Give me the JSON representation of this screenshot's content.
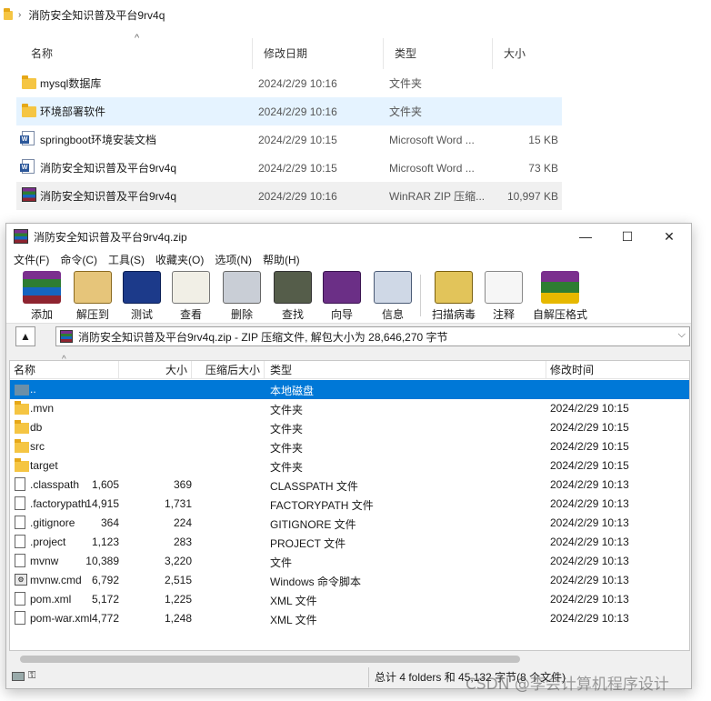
{
  "explorer": {
    "breadcrumb": "消防安全知识普及平台9rv4q",
    "headers": [
      "名称",
      "修改日期",
      "类型",
      "大小"
    ],
    "rows": [
      {
        "name": "mysql数据库",
        "date": "2024/2/29 10:16",
        "type": "文件夹",
        "size": "",
        "icon": "folder-icon"
      },
      {
        "name": "环境部署软件",
        "date": "2024/2/29 10:16",
        "type": "文件夹",
        "size": "",
        "icon": "folder-icon"
      },
      {
        "name": "springboot环境安装文档",
        "date": "2024/2/29 10:15",
        "type": "Microsoft Word ...",
        "size": "15 KB",
        "icon": "word-doc-icon"
      },
      {
        "name": "消防安全知识普及平台9rv4q",
        "date": "2024/2/29 10:15",
        "type": "Microsoft Word ...",
        "size": "73 KB",
        "icon": "word-doc-icon"
      },
      {
        "name": "消防安全知识普及平台9rv4q",
        "date": "2024/2/29 10:16",
        "type": "WinRAR ZIP 压缩...",
        "size": "10,997 KB",
        "icon": "winrar-archive-icon"
      }
    ]
  },
  "winrar": {
    "title": "消防安全知识普及平台9rv4q.zip",
    "window_buttons": {
      "minimize": "—",
      "maximize": "☐",
      "close": "✕"
    },
    "menu": [
      "文件(F)",
      "命令(C)",
      "工具(S)",
      "收藏夹(O)",
      "选项(N)",
      "帮助(H)"
    ],
    "toolbar": [
      "添加",
      "解压到",
      "测试",
      "查看",
      "删除",
      "查找",
      "向导",
      "信息",
      "扫描病毒",
      "注释",
      "自解压格式"
    ],
    "address": "消防安全知识普及平台9rv4q.zip - ZIP 压缩文件, 解包大小为 28,646,270 字节",
    "columns": [
      "名称",
      "大小",
      "压缩后大小",
      "类型",
      "修改时间"
    ],
    "rows": [
      {
        "name": "..",
        "size": "",
        "packed": "",
        "type": "本地磁盘",
        "date": "",
        "icon": "folder-up-icon"
      },
      {
        "name": ".mvn",
        "size": "",
        "packed": "",
        "type": "文件夹",
        "date": "2024/2/29 10:15",
        "icon": "folder-icon"
      },
      {
        "name": "db",
        "size": "",
        "packed": "",
        "type": "文件夹",
        "date": "2024/2/29 10:15",
        "icon": "folder-icon"
      },
      {
        "name": "src",
        "size": "",
        "packed": "",
        "type": "文件夹",
        "date": "2024/2/29 10:15",
        "icon": "folder-icon"
      },
      {
        "name": "target",
        "size": "",
        "packed": "",
        "type": "文件夹",
        "date": "2024/2/29 10:15",
        "icon": "folder-icon"
      },
      {
        "name": ".classpath",
        "size": "1,605",
        "packed": "369",
        "type": "CLASSPATH 文件",
        "date": "2024/2/29 10:13",
        "icon": "file-icon"
      },
      {
        "name": ".factorypath",
        "size": "14,915",
        "packed": "1,731",
        "type": "FACTORYPATH 文件",
        "date": "2024/2/29 10:13",
        "icon": "file-icon"
      },
      {
        "name": ".gitignore",
        "size": "364",
        "packed": "224",
        "type": "GITIGNORE 文件",
        "date": "2024/2/29 10:13",
        "icon": "file-icon"
      },
      {
        "name": ".project",
        "size": "1,123",
        "packed": "283",
        "type": "PROJECT 文件",
        "date": "2024/2/29 10:13",
        "icon": "file-icon"
      },
      {
        "name": "mvnw",
        "size": "10,389",
        "packed": "3,220",
        "type": "文件",
        "date": "2024/2/29 10:13",
        "icon": "file-icon"
      },
      {
        "name": "mvnw.cmd",
        "size": "6,792",
        "packed": "2,515",
        "type": "Windows 命令脚本",
        "date": "2024/2/29 10:13",
        "icon": "cmd-script-icon"
      },
      {
        "name": "pom.xml",
        "size": "5,172",
        "packed": "1,225",
        "type": "XML 文件",
        "date": "2024/2/29 10:13",
        "icon": "file-icon"
      },
      {
        "name": "pom-war.xml",
        "size": "4,772",
        "packed": "1,248",
        "type": "XML 文件",
        "date": "2024/2/29 10:13",
        "icon": "file-icon"
      }
    ],
    "status": "总计 4 folders 和 45,132 字节(8 个文件)"
  },
  "watermark": "CSDN @李会计算机程序设计",
  "colors": {
    "selection": "#0078d7",
    "folder": "#f5c543",
    "explorer_selection": "#e5f3ff"
  }
}
